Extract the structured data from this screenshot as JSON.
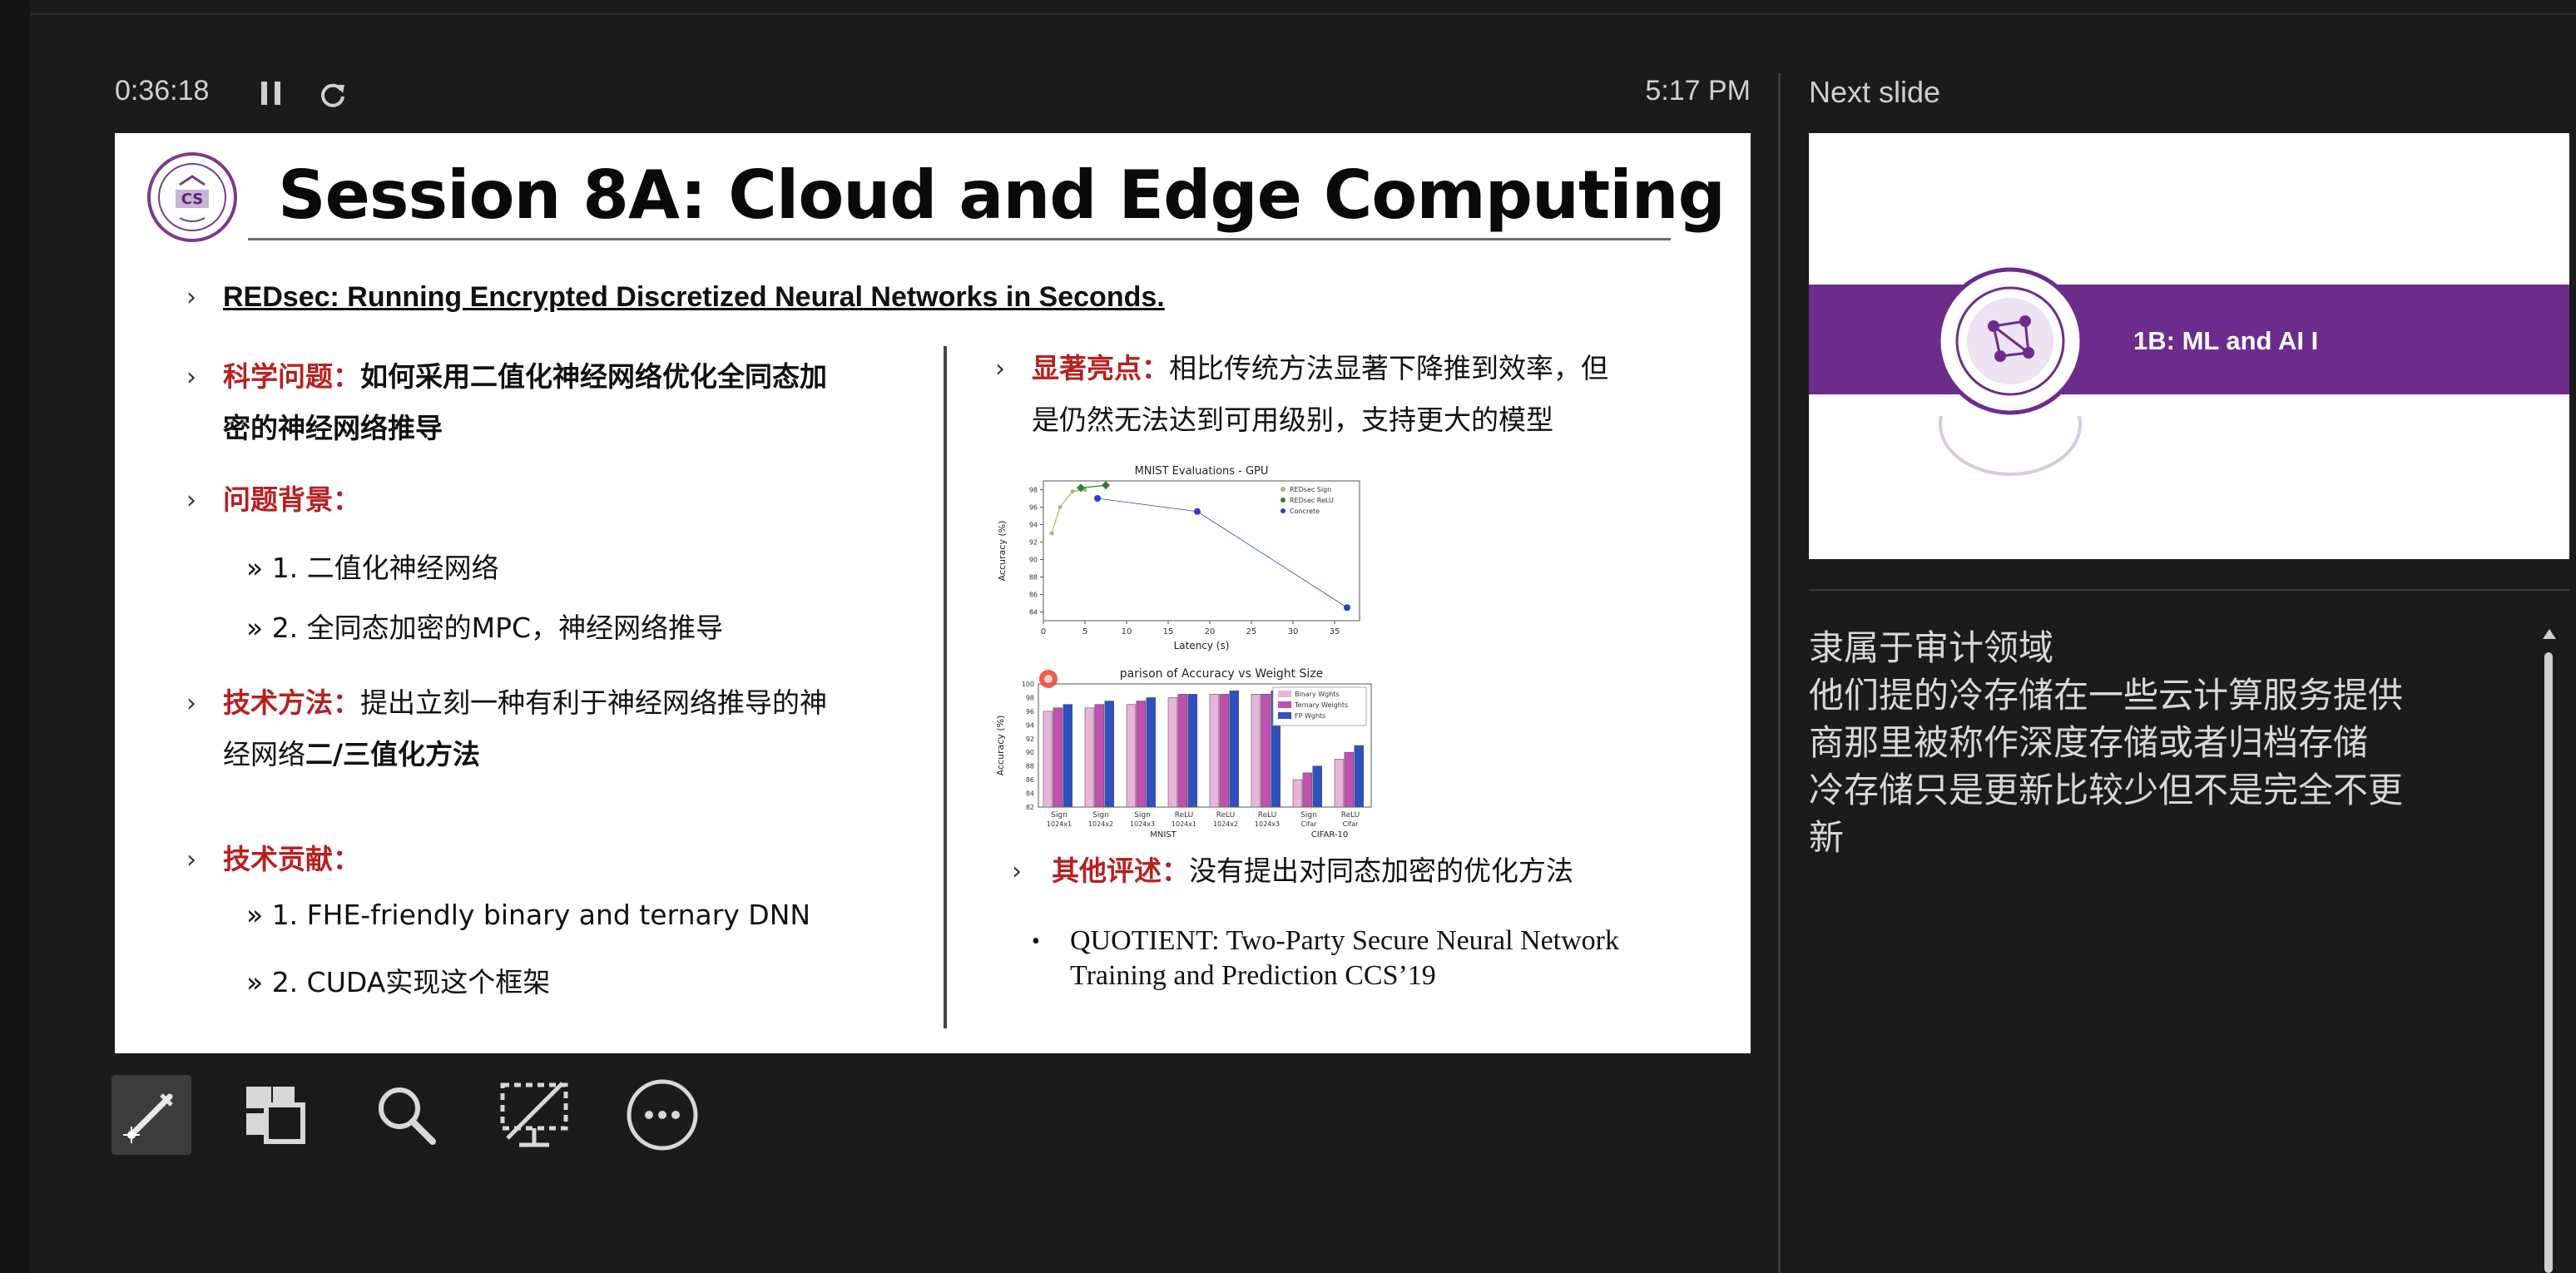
{
  "status": {
    "elapsed_time": "0:36:18",
    "clock": "5:17 PM"
  },
  "slide": {
    "title": "Session 8A: Cloud and Edge Computing",
    "paper": "REDsec: Running Encrypted Discretized Neural Networks in Seconds.",
    "left": {
      "q_label": "科学问题：",
      "q_text_1": "如何采用二值化神经网络优化全同态加",
      "q_text_2": "密的神经网络推导",
      "bg_label": "问题背景：",
      "bg_items": [
        "1. 二值化神经网络",
        "2. 全同态加密的MPC，神经网络推导"
      ],
      "method_label": "技术方法：",
      "method_text_1": "提出立刻一种有利于神经网络推导的神",
      "method_text_2a": "经网络",
      "method_text_2b": "二/三值化方法",
      "contrib_label": "技术贡献：",
      "contrib_items": [
        "1. FHE-friendly binary and ternary DNN",
        "2. CUDA实现这个框架"
      ]
    },
    "right": {
      "highlight_label": "显著亮点：",
      "highlight_text_1": "相比传统方法显著下降推到效率，但",
      "highlight_text_2": "是仍然无法达到可用级别，支持更大的模型",
      "other_label": "其他评述：",
      "other_text": "没有提出对同态加密的优化方法",
      "ref_bullet": "•",
      "ref_line_1": "QUOTIENT: Two-Party Secure Neural Network",
      "ref_line_2": "Training and Prediction CCS’19"
    }
  },
  "chart_data": [
    {
      "type": "line",
      "title": "MNIST Evaluations - GPU",
      "xlabel": "Latency (s)",
      "ylabel": "Accuracy (%)",
      "xlim": [
        0,
        38
      ],
      "ylim": [
        83,
        99
      ],
      "xticks": [
        "0",
        "5",
        "10",
        "15",
        "20",
        "25",
        "30",
        "35"
      ],
      "yticks": [
        "84",
        "86",
        "88",
        "90",
        "92",
        "94",
        "96",
        "98"
      ],
      "legend": "top-right",
      "series": [
        {
          "name": "REDsec Sign",
          "color": "#9bbf6a",
          "points": [
            [
              1,
              93
            ],
            [
              2,
              96
            ],
            [
              3.5,
              97.8
            ],
            [
              5,
              98
            ]
          ]
        },
        {
          "name": "REDsec ReLU",
          "color": "#2e7d32",
          "points": [
            [
              4.5,
              98.2
            ],
            [
              7.5,
              98.5
            ]
          ]
        },
        {
          "name": "Concrete",
          "color": "#2b3fc9",
          "points": [
            [
              6.5,
              97
            ],
            [
              18.5,
              95.5
            ],
            [
              36.5,
              84.5
            ]
          ]
        }
      ]
    },
    {
      "type": "bar",
      "title": "Comparison of Accuracy vs Weight Size",
      "title_visible": "parison of Accuracy vs Weight Size",
      "ylabel": "Accuracy (%)",
      "ylim": [
        82,
        100
      ],
      "yticks": [
        "82",
        "84",
        "86",
        "88",
        "90",
        "92",
        "94",
        "96",
        "98",
        "100"
      ],
      "categories": [
        "Sign 1024x1",
        "Sign 1024x2",
        "Sign 1024x3",
        "ReLU 1024x1",
        "ReLU 1024x2",
        "ReLU 1024x3",
        "Sign Cifar",
        "ReLU Cifar"
      ],
      "groups": [
        "MNIST",
        "CIFAR-10"
      ],
      "legend": "top-right",
      "series": [
        {
          "name": "Binary Wghts",
          "color": "#e8b4d8",
          "values": [
            96,
            96.5,
            97,
            98,
            98.5,
            98.5,
            86,
            89
          ]
        },
        {
          "name": "Ternary Weights",
          "color": "#c050b0",
          "values": [
            96.5,
            97,
            97.5,
            98.5,
            98.5,
            98.5,
            87,
            90
          ]
        },
        {
          "name": "FP Wghts",
          "color": "#3050c0",
          "values": [
            97,
            97.5,
            98,
            98.5,
            99,
            99,
            88,
            91
          ]
        }
      ]
    }
  ],
  "next_slide": {
    "label": "Next slide",
    "title": "1B: ML and AI I",
    "band_color": "#6c2c8c"
  },
  "notes": {
    "lines": [
      "隶属于审计领域",
      "他们提的冷存储在一些云计算服务提供",
      "商那里被称作深度存储或者归档存储",
      "冷存储只是更新比较少但不是完全不更",
      "新"
    ]
  },
  "toolbar": {
    "tools": [
      "pen-tool",
      "slides-grid",
      "zoom",
      "black-screen",
      "more-options"
    ]
  }
}
